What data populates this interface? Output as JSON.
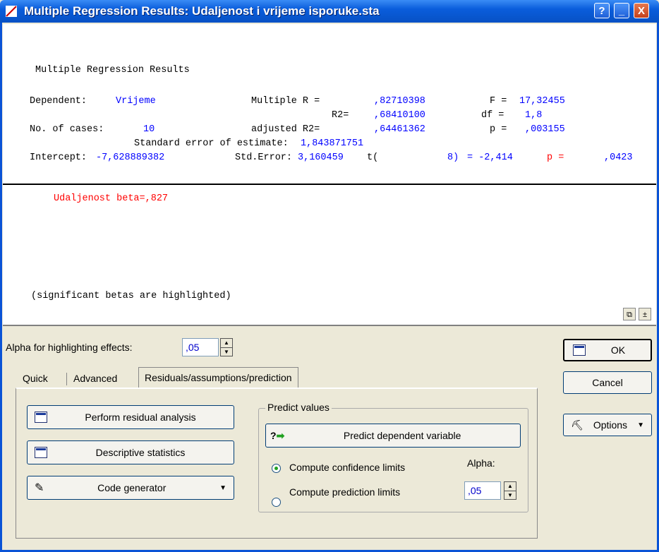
{
  "window": {
    "title": "Multiple Regression Results: Udaljenost i vrijeme isporuke.sta",
    "help_label": "?",
    "min_label": "_",
    "close_label": "X"
  },
  "results": {
    "heading": "Multiple Regression Results",
    "dependent_label": "Dependent:",
    "dependent_value": "Vrijeme",
    "multiple_r_label": "Multiple R =",
    "multiple_r_value": ",82710398",
    "f_label": "F =",
    "f_value": "17,32455",
    "r2_label": "R2=",
    "r2_value": ",68410100",
    "df_label": "df =",
    "df_value": "1,8",
    "cases_label": "No. of cases:",
    "cases_value": "10",
    "adj_r2_label": "adjusted R2=",
    "adj_r2_value": ",64461362",
    "p_label": "p =",
    "p_value": ",003155",
    "std_err_est_label": "Standard error of estimate:",
    "std_err_est_value": "1,843871751",
    "intercept_label": "Intercept:",
    "intercept_value": "-7,628889382",
    "std_error_label": "Std.Error:",
    "std_error_value": "3,160459",
    "t_label": "t(",
    "t_df": "8)",
    "t_value": "= -2,414",
    "p2_label": "p =",
    "p2_value": ",0423",
    "beta_line": "Udaljenost beta=,827",
    "footnote": "(significant betas are highlighted)"
  },
  "alpha_highlight": {
    "label": "Alpha for highlighting effects:",
    "value": ",05"
  },
  "tabs": [
    {
      "label": "Quick"
    },
    {
      "label": "Advanced"
    },
    {
      "label": "Residuals/assumptions/prediction"
    }
  ],
  "buttons": {
    "residual": "Perform residual analysis",
    "descriptive": "Descriptive statistics",
    "code_gen": "Code generator",
    "predict": "Predict dependent variable",
    "ok": "OK",
    "cancel": "Cancel",
    "options": "Options"
  },
  "predict_group": {
    "title": "Predict values",
    "confidence": "Compute confidence limits",
    "prediction": "Compute prediction limits",
    "alpha_label": "Alpha:",
    "alpha_value": ",05",
    "selected": "confidence"
  },
  "icons": {
    "app": "regression-icon",
    "copy": "copy-icon",
    "sort": "sort-icon"
  }
}
